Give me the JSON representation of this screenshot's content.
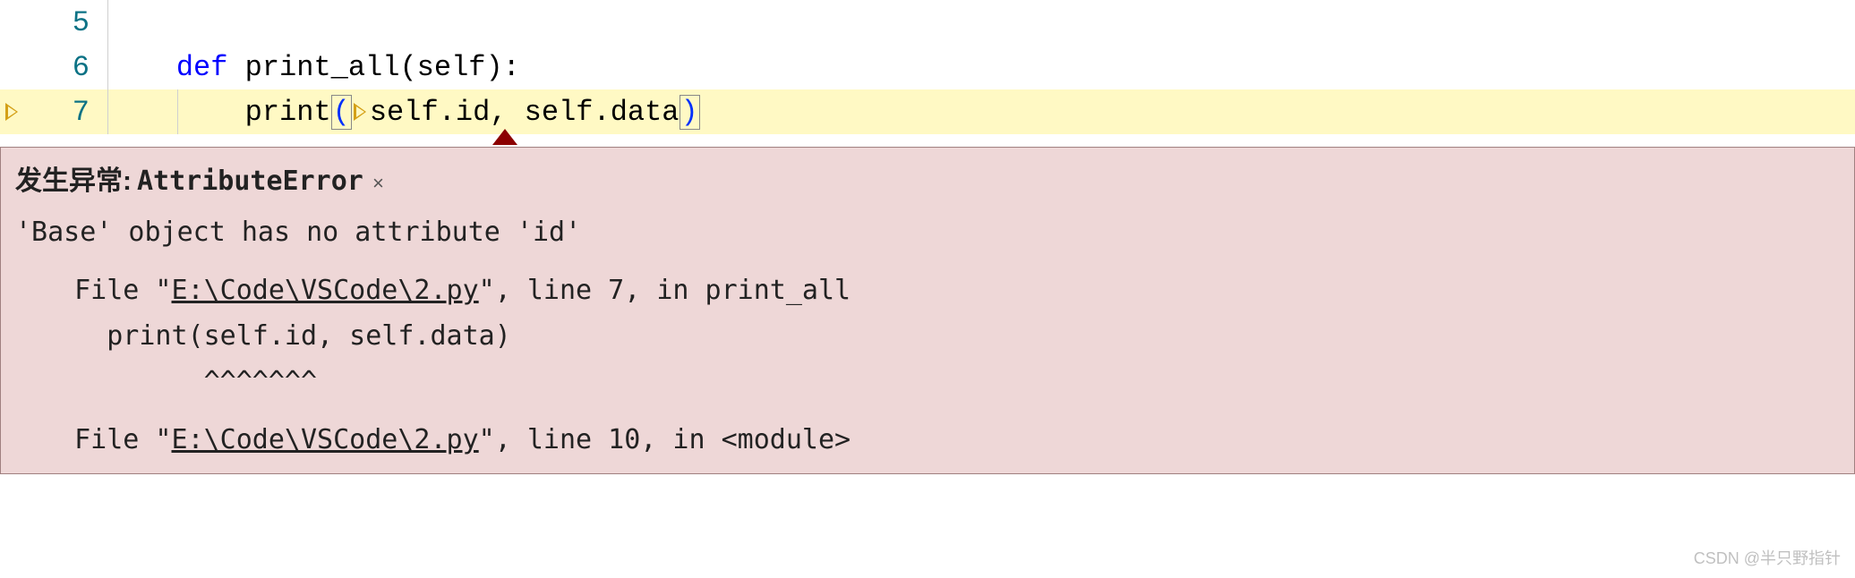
{
  "editor": {
    "lines": {
      "l5": {
        "num": "5"
      },
      "l6": {
        "num": "6",
        "kw_def": "def",
        "fn_name": "print_all",
        "params": "self",
        "colon": ":"
      },
      "l7": {
        "num": "7",
        "fn_call": "print",
        "open": "(",
        "arg1a": "self",
        "dot1": ".",
        "arg1b": "id",
        "comma": ", ",
        "arg2a": "self",
        "dot2": ".",
        "arg2b": "data",
        "close": ")"
      }
    }
  },
  "exception": {
    "title_prefix": "发生异常: ",
    "error_type": "AttributeError",
    "close_glyph": "×",
    "message": "'Base' object has no attribute 'id'",
    "trace1_pre": "  File \"",
    "trace1_file": "E:\\Code\\VSCode\\2.py",
    "trace1_post": "\", line 7, in print_all",
    "trace1_code": "    print(self.id, self.data)",
    "trace1_carets": "          ^^^^^^^",
    "trace2_pre": "  File \"",
    "trace2_file": "E:\\Code\\VSCode\\2.py",
    "trace2_post": "\", line 10, in <module>"
  },
  "watermark": "CSDN @半只野指针"
}
